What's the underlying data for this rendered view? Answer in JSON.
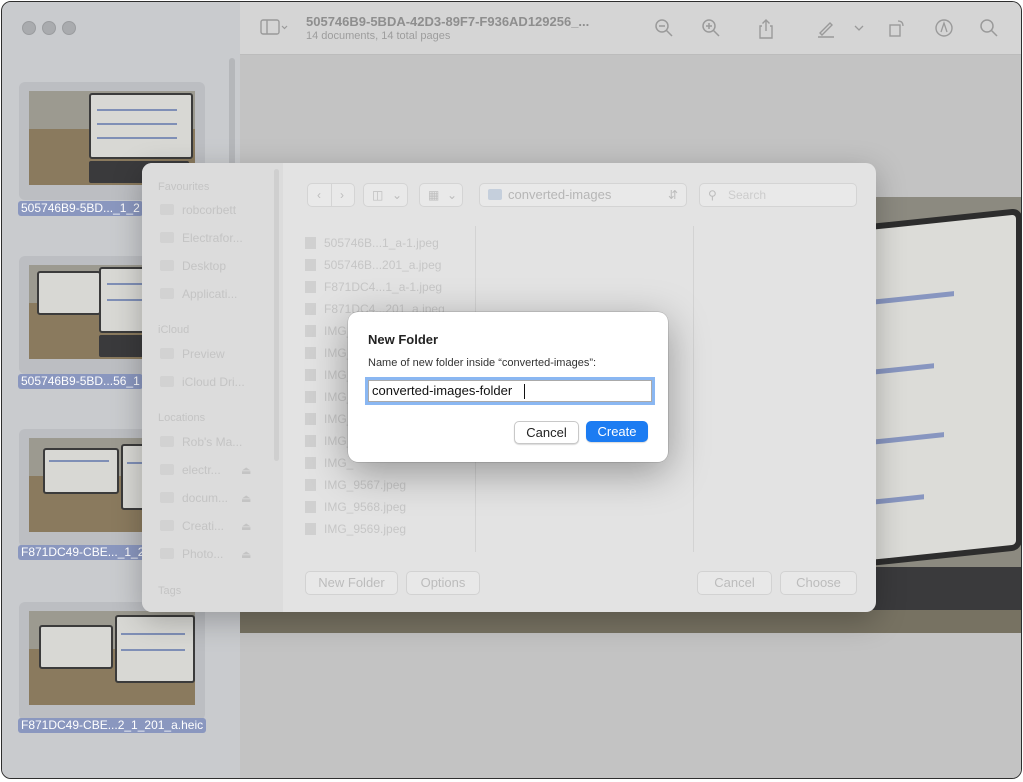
{
  "document": {
    "title": "505746B9-5BDA-42D3-89F7-F936AD129256_...",
    "subtitle": "14 documents, 14 total pages"
  },
  "thumbnails": [
    {
      "label": "505746B9-5BD..._1_2"
    },
    {
      "label": "505746B9-5BD...56_1"
    },
    {
      "label": "F871DC49-CBE..._1_2"
    },
    {
      "label": "F871DC49-CBE...2_1_201_a.heic"
    }
  ],
  "toolbar_icons": [
    "sidebar-toggle-icon",
    "zoom-out-icon",
    "zoom-in-icon",
    "share-icon",
    "markup-pen-icon",
    "rotate-icon",
    "annotate-icon",
    "search-icon"
  ],
  "save_sheet": {
    "location": "converted-images",
    "search_placeholder": "Search",
    "sidebar": {
      "favourites_header": "Favourites",
      "favourites": [
        "robcorbett",
        "Electrafor...",
        "Desktop",
        "Applicati..."
      ],
      "icloud_header": "iCloud",
      "icloud": [
        "Preview",
        "iCloud Dri..."
      ],
      "locations_header": "Locations",
      "locations": [
        "Rob's Ma...",
        "electr...",
        "docum...",
        "Creati...",
        "Photo..."
      ],
      "tags_header": "Tags"
    },
    "files": [
      "505746B...1_a-1.jpeg",
      "505746B...201_a.jpeg",
      "F871DC4...1_a-1.jpeg",
      "F871DC4...201_a.jpeg",
      "IMG_",
      "IMG_",
      "IMG_",
      "IMG_",
      "IMG_",
      "IMG_",
      "IMG_",
      "IMG_9567.jpeg",
      "IMG_9568.jpeg",
      "IMG_9569.jpeg"
    ],
    "new_folder_label": "New Folder",
    "options_label": "Options",
    "cancel_label": "Cancel",
    "choose_label": "Choose"
  },
  "new_folder_dialog": {
    "title": "New Folder",
    "message": "Name of new folder inside “converted-images”:",
    "value": "converted-images-folder",
    "cancel_label": "Cancel",
    "create_label": "Create"
  },
  "colors": {
    "accent": "#1c7cf2",
    "selection": "#8a97bf"
  }
}
